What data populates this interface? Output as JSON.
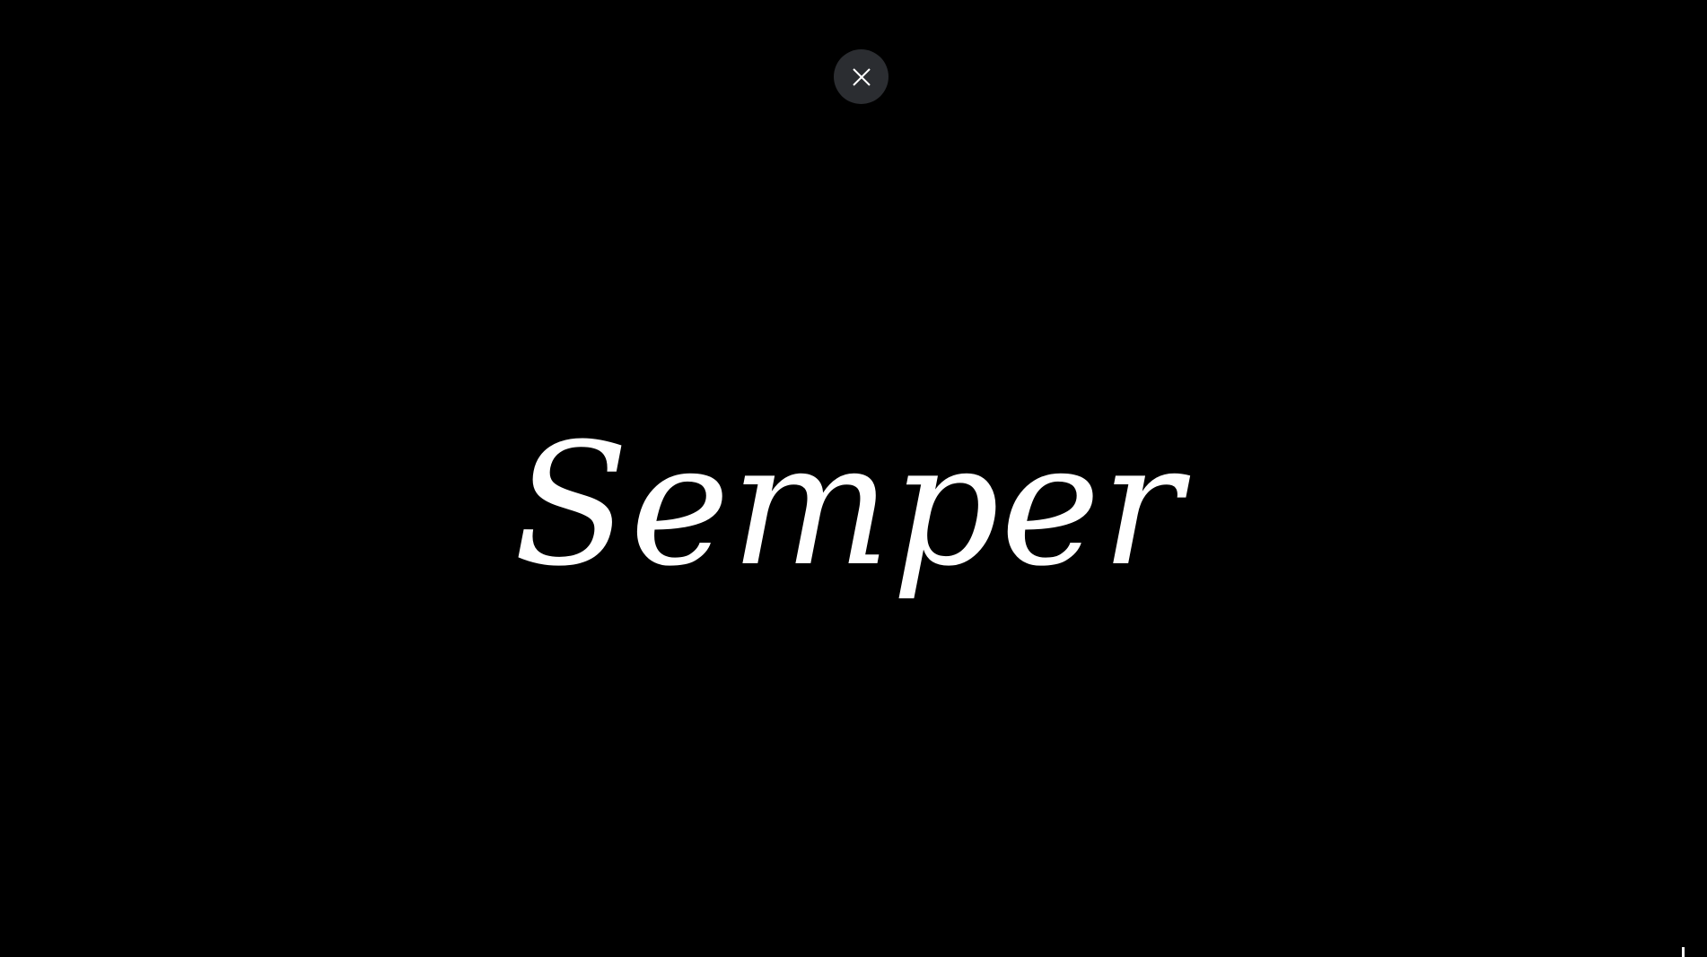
{
  "overlay": {
    "background_color": "#000000",
    "close_button": {
      "icon": "close-icon",
      "background_color": "#2b2d31",
      "icon_color": "#ffffff"
    },
    "wordmark": {
      "text": "Semper",
      "color": "#ffffff"
    }
  }
}
